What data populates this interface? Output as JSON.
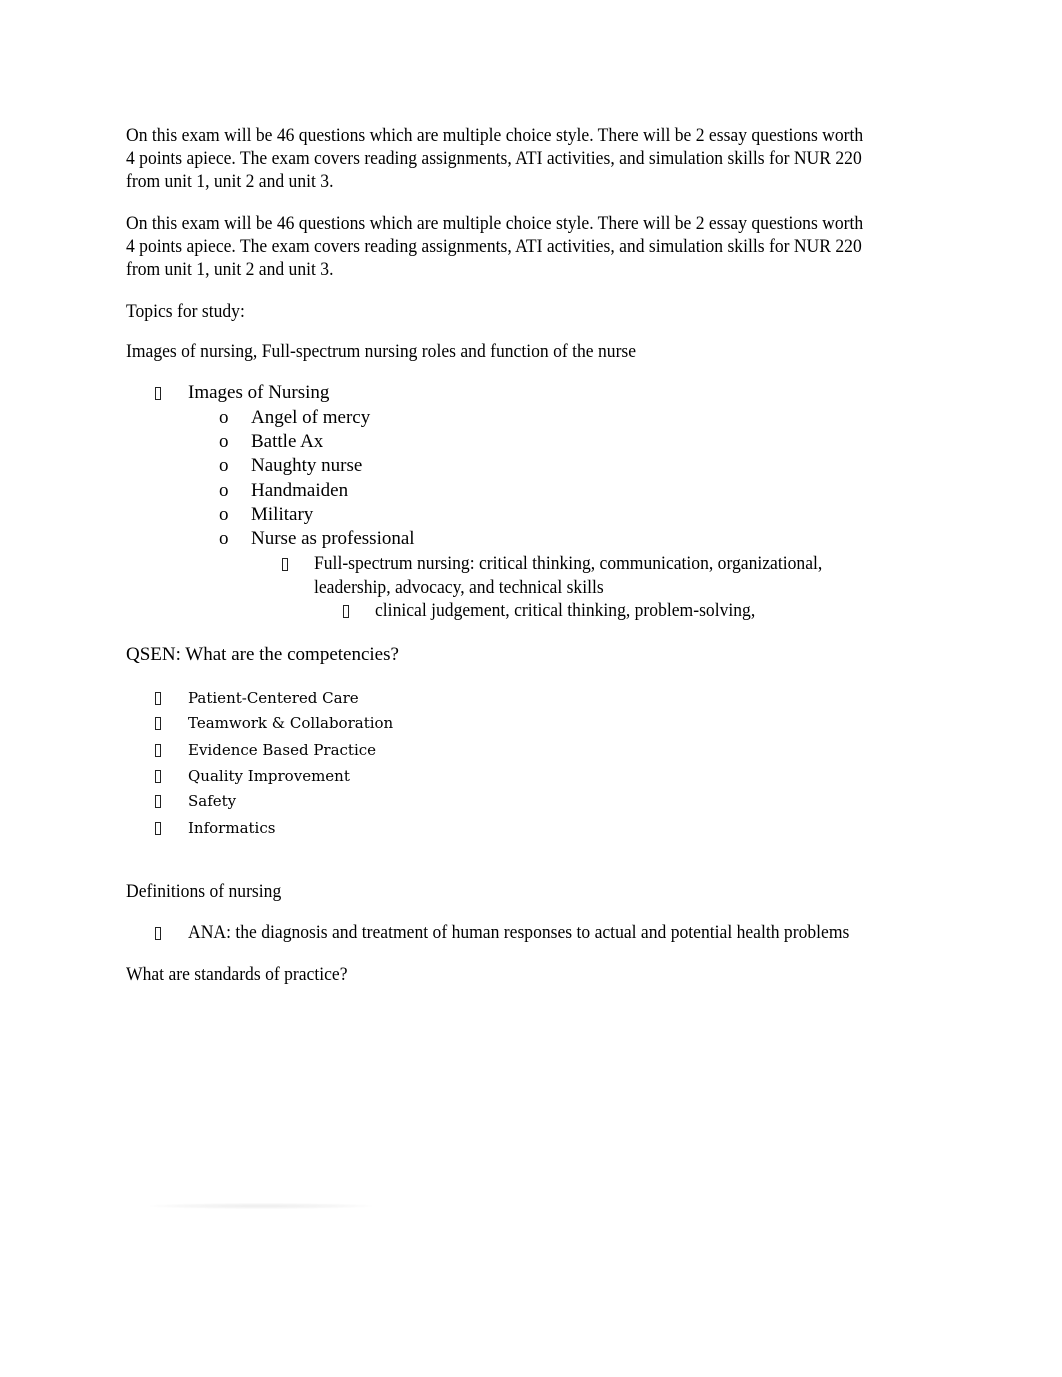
{
  "intro_paragraphs": [
    {
      "lines": [
        "On this exam will be 46 questions which are multiple choice style. There will be 2 essay questions worth",
        "4 points apiece. The exam covers reading assignments, ATI activities, and simulation skills for NUR 220",
        "from unit 1, unit 2 and unit 3."
      ]
    },
    {
      "lines": [
        "On this exam will be 46 questions which are multiple choice style. There will be 2 essay questions worth",
        "4 points apiece. The exam covers reading assignments, ATI activities, and simulation skills for NUR 220",
        "from unit 1, unit 2 and unit 3."
      ]
    }
  ],
  "topics_heading": "Topics for study:",
  "section_images": {
    "heading": "Images of nursing, Full-spectrum nursing roles and function of the nurse",
    "item": "Images of Nursing",
    "sub_bullet_glyph": "o",
    "sub_items": [
      "Angel of mercy",
      "Battle Ax",
      "Naughty nurse",
      "Handmaiden",
      "Military",
      "Nurse as professional"
    ],
    "level3_lines": [
      "Full-spectrum nursing: critical thinking, communication, organizational,",
      "leadership, advocacy, and technical skills"
    ],
    "level4_item": "clinical judgement, critical thinking, problem-solving,"
  },
  "section_qsen": {
    "heading": "QSEN: What are the competencies?",
    "items": [
      "Patient-Centered Care",
      "Teamwork & Collaboration",
      "Evidence Based Practice",
      "Quality Improvement",
      "Safety",
      "Informatics"
    ]
  },
  "section_definitions": {
    "heading": "Definitions of nursing",
    "items": [
      "ANA: the diagnosis and treatment of human responses to actual and potential health problems"
    ]
  },
  "section_standards": {
    "heading": "What are standards of practice?"
  }
}
